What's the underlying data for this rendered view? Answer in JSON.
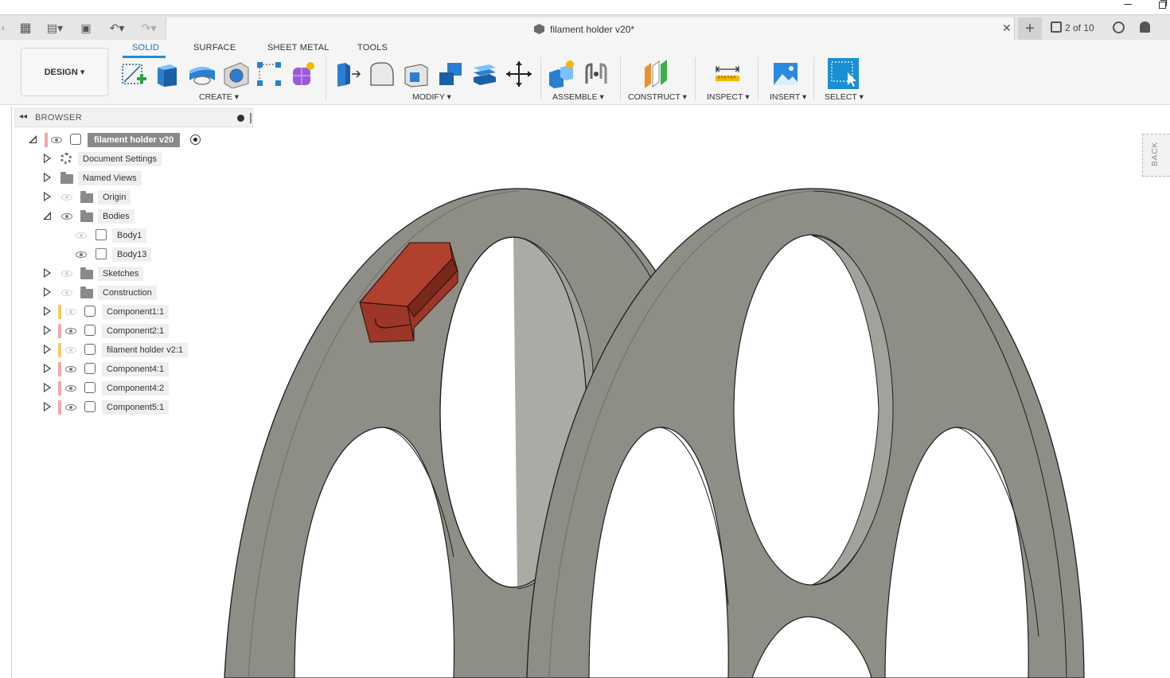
{
  "window": {
    "minimize_icon": "minimize-icon",
    "restore_icon": "restore-icon"
  },
  "document": {
    "title": "filament holder v20*",
    "jobs": "2 of 10"
  },
  "ribbon": {
    "workspace": "DESIGN ▾",
    "tabs": [
      {
        "label": "SOLID",
        "active": true
      },
      {
        "label": "SURFACE",
        "active": false
      },
      {
        "label": "SHEET METAL",
        "active": false
      },
      {
        "label": "TOOLS",
        "active": false
      }
    ],
    "groups": {
      "create": "CREATE ▾",
      "modify": "MODIFY ▾",
      "assemble": "ASSEMBLE ▾",
      "construct": "CONSTRUCT ▾",
      "inspect": "INSPECT ▾",
      "insert": "INSERT ▾",
      "select": "SELECT ▾"
    }
  },
  "browser": {
    "title": "BROWSER",
    "root": "filament holder v20",
    "items": [
      {
        "label": "Document Settings"
      },
      {
        "label": "Named Views"
      },
      {
        "label": "Origin"
      },
      {
        "label": "Bodies"
      },
      {
        "label": "Body1"
      },
      {
        "label": "Body13"
      },
      {
        "label": "Sketches"
      },
      {
        "label": "Construction"
      },
      {
        "label": "Component1:1"
      },
      {
        "label": "Component2:1"
      },
      {
        "label": "filament holder v2:1"
      },
      {
        "label": "Component4:1"
      },
      {
        "label": "Component4:2"
      },
      {
        "label": "Component5:1"
      }
    ]
  },
  "viewcube": {
    "face": "BACK"
  },
  "colors": {
    "accent": "#1a8fd6",
    "model": "#8e8d86",
    "part": "#a33a2a"
  }
}
